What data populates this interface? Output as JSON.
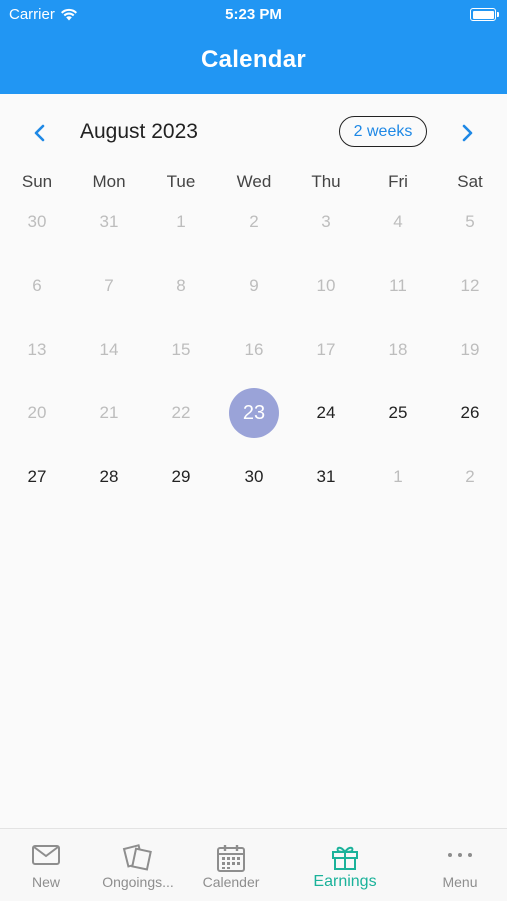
{
  "status_bar": {
    "carrier": "Carrier",
    "time": "5:23 PM"
  },
  "header": {
    "title": "Calendar"
  },
  "month_nav": {
    "month_label": "August 2023",
    "range_button": "2 weeks"
  },
  "weekdays": [
    "Sun",
    "Mon",
    "Tue",
    "Wed",
    "Thu",
    "Fri",
    "Sat"
  ],
  "weeks": [
    [
      {
        "d": "30",
        "s": "muted"
      },
      {
        "d": "31",
        "s": "muted"
      },
      {
        "d": "1",
        "s": "muted"
      },
      {
        "d": "2",
        "s": "muted"
      },
      {
        "d": "3",
        "s": "muted"
      },
      {
        "d": "4",
        "s": "muted"
      },
      {
        "d": "5",
        "s": "muted"
      }
    ],
    [
      {
        "d": "6",
        "s": "muted"
      },
      {
        "d": "7",
        "s": "muted"
      },
      {
        "d": "8",
        "s": "muted"
      },
      {
        "d": "9",
        "s": "muted"
      },
      {
        "d": "10",
        "s": "muted"
      },
      {
        "d": "11",
        "s": "muted"
      },
      {
        "d": "12",
        "s": "muted"
      }
    ],
    [
      {
        "d": "13",
        "s": "muted"
      },
      {
        "d": "14",
        "s": "muted"
      },
      {
        "d": "15",
        "s": "muted"
      },
      {
        "d": "16",
        "s": "muted"
      },
      {
        "d": "17",
        "s": "muted"
      },
      {
        "d": "18",
        "s": "muted"
      },
      {
        "d": "19",
        "s": "muted"
      }
    ],
    [
      {
        "d": "20",
        "s": "muted"
      },
      {
        "d": "21",
        "s": "muted"
      },
      {
        "d": "22",
        "s": "muted"
      },
      {
        "d": "23",
        "s": "selected"
      },
      {
        "d": "24",
        "s": "active"
      },
      {
        "d": "25",
        "s": "active"
      },
      {
        "d": "26",
        "s": "active"
      }
    ],
    [
      {
        "d": "27",
        "s": "active"
      },
      {
        "d": "28",
        "s": "active"
      },
      {
        "d": "29",
        "s": "active"
      },
      {
        "d": "30",
        "s": "active"
      },
      {
        "d": "31",
        "s": "active"
      },
      {
        "d": "1",
        "s": "muted"
      },
      {
        "d": "2",
        "s": "muted"
      }
    ]
  ],
  "colors": {
    "header": "#2196f3",
    "nav_arrow": "#1e88e5",
    "selected_day": "#9aa3d8",
    "active_tab": "#1bb29a",
    "inactive_tab": "#8e8e8e"
  },
  "tabs": [
    {
      "label": "New",
      "icon": "envelope-icon",
      "active": false
    },
    {
      "label": "Ongoings...",
      "icon": "documents-icon",
      "active": false
    },
    {
      "label": "Calender",
      "icon": "calendar-icon",
      "active": false
    },
    {
      "label": "Earnings",
      "icon": "gift-icon",
      "active": true
    },
    {
      "label": "Menu",
      "icon": "more-dots-icon",
      "active": false
    }
  ]
}
